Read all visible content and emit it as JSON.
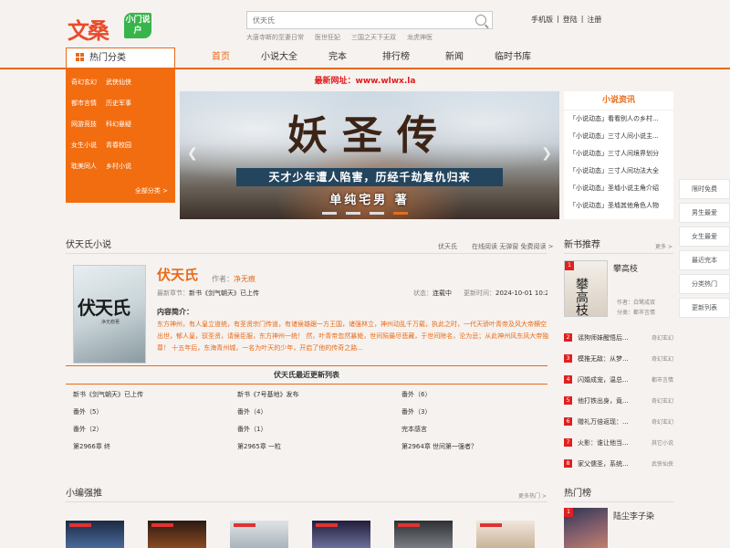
{
  "header": {
    "logo_text": "文桑",
    "logo_badge": "小门说户",
    "search_placeholder": "伏天氏",
    "hot_searches": [
      "大唐寺断的至妻日常",
      "医世狂妃",
      "三国之天下无双",
      "龙虎神医"
    ],
    "links": [
      "手机版",
      "|",
      "登陆",
      "|",
      "注册"
    ]
  },
  "nav": {
    "category_button": "热门分类",
    "items": [
      "首页",
      "小说大全",
      "完本",
      "排行榜",
      "新闻",
      "临时书库"
    ],
    "active_index": 0,
    "categories": [
      [
        "奇幻玄幻",
        "武侠仙侠"
      ],
      [
        "都市言情",
        "历史军事"
      ],
      [
        "网游竞技",
        "科幻悬疑"
      ],
      [
        "女生小说",
        "青春校园"
      ],
      [
        "耽美同人",
        "乡村小说"
      ]
    ],
    "all_categories": "全部分类 >"
  },
  "notice": "最新网址：www.wlwx.la",
  "banner": {
    "title": "妖圣传",
    "subtitle": "天才少年遭人陷害，历经千劫复仇归来",
    "author": "单纯宅男 著",
    "dot_count": 4,
    "active_dot": 3
  },
  "news": {
    "title": "小说资讯",
    "items": [
      "「小说动态」看看别人の乡村...",
      "「小说动态」三寸人间小说主...",
      "「小说动态」三寸人间境界划分",
      "「小说动态」三寸人间功法大全",
      "「小说动态」圣墟小说主角介绍",
      "「小说动态」圣墟其他角色人物"
    ]
  },
  "floatbar": [
    "限时免费",
    "男生最爱",
    "女生最爱",
    "最近完本",
    "分类热门",
    "更新列表"
  ],
  "book_section": {
    "title": "伏天氏小说",
    "meta": [
      "伏天氏",
      "在线阅读 无弹窗 免费阅读 >"
    ]
  },
  "book": {
    "cover_title": "伏天氏",
    "cover_author": "净无痕著",
    "title": "伏天氏",
    "author_label": "作者：",
    "author": "净无痕",
    "latest_label": "最新章节：",
    "latest": "新书《剑气朝天》已上传",
    "status_label": "状态：",
    "status": "连载中",
    "update_label": "更新时间：",
    "update": "2024-10-01 10:23",
    "intro_label": "内容简介：",
    "intro": "东方神州，有人皇立道统，有圣贤宗门传道，有诸侯雄踞一方王国，诸强林立，神州动乱千万载，执此之时，一代天骄叶青帝及风大帝横空出世，郁人皇，驭圣贤，请侯臣服，东方神州一统！ 然，叶青帝忽然暴毙，世间殒最尽悲藏，于世间除名，沦为忌；从此神州风东风大帝独尊！ 十五年后，东海青州城，一名为叶天的少年，开启了他的传奇之路..."
  },
  "chapters": {
    "title": "伏天氏最近更新列表",
    "items": [
      "新书《剑气朝天》已上传",
      "新书《7号基地》发布",
      "番外（6）",
      "番外（5）",
      "番外（4）",
      "番外（3）",
      "番外（2）",
      "番外（1）",
      "完本感言",
      "第2966章 终",
      "第2965章 一粒",
      "第2964章 世间第一强者？"
    ]
  },
  "newbooks": {
    "title": "新书推荐",
    "more": "更多 >",
    "top": {
      "rank": "1",
      "cover_text": "攀高枝",
      "title": "攀高枝",
      "author": "作者：白鹭成双",
      "category": "分类：都市言情"
    },
    "list": [
      {
        "rank": "2",
        "title": "谣狗师妹醒悟后...",
        "category": "奇幻玄幻"
      },
      {
        "rank": "3",
        "title": "模推无敌：从梦...",
        "category": "奇幻玄幻"
      },
      {
        "rank": "4",
        "title": "闪婚成宠，温总...",
        "category": "都市言情"
      },
      {
        "rank": "5",
        "title": "他打铁出身，竟...",
        "category": "奇幻玄幻"
      },
      {
        "rank": "6",
        "title": "赠礼万倍返现：...",
        "category": "奇幻玄幻"
      },
      {
        "rank": "7",
        "title": "火影：谁让他当...",
        "category": "其它小说"
      },
      {
        "rank": "8",
        "title": "家父儒圣，系统...",
        "category": "武侠仙侠"
      }
    ]
  },
  "editor_pick": {
    "title": "小编强推",
    "more": "更多热门 >"
  },
  "hot": {
    "title": "热门榜",
    "rank": "1",
    "book": "陆尘李子染"
  },
  "colors": {
    "accent": "#e86a1a",
    "menu_bg": "#f26d10",
    "rank_red": "#e02020",
    "notice_red": "#e01c1c"
  }
}
